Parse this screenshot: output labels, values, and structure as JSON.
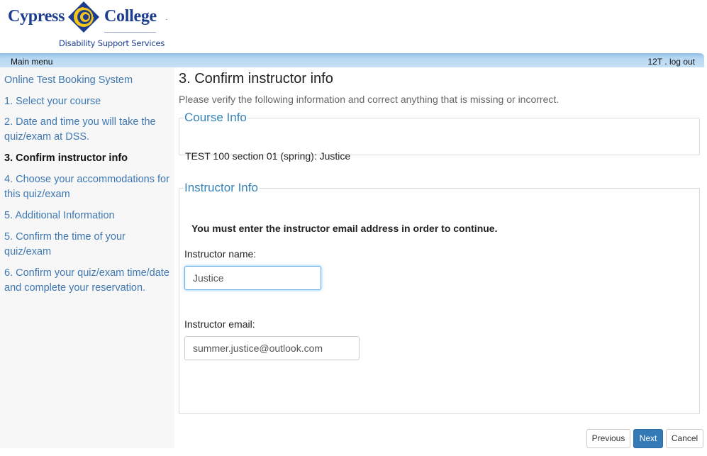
{
  "header": {
    "logo": {
      "word_left": "Cypress",
      "word_right": "College",
      "subtitle": "Disability Support Services",
      "colors": {
        "navy": "#1c3d8f",
        "gold": "#f5c518"
      }
    }
  },
  "menubar": {
    "main_menu_label": "Main menu",
    "user_label": "12T",
    "separator": " . ",
    "logout_label": "log out"
  },
  "sidebar": {
    "items": [
      {
        "label": "Online Test Booking System",
        "active": false
      },
      {
        "label": "1. Select your course",
        "active": false
      },
      {
        "label": "2. Date and time you will take the quiz/exam at DSS.",
        "active": false
      },
      {
        "label": "3. Confirm instructor info",
        "active": true
      },
      {
        "label": "4. Choose your accommodations for this quiz/exam",
        "active": false
      },
      {
        "label": "5. Additional Information",
        "active": false
      },
      {
        "label": "5. Confirm the time of your quiz/exam",
        "active": false
      },
      {
        "label": "6. Confirm your quiz/exam time/date and complete your reservation.",
        "active": false
      }
    ]
  },
  "main": {
    "title": "3. Confirm instructor info",
    "intro": "Please verify the following information and correct anything that is missing or incorrect.",
    "course_info": {
      "legend": "Course Info",
      "text": "TEST 100 section 01 (spring): Justice"
    },
    "instructor_info": {
      "legend": "Instructor Info",
      "warning": "You must enter the instructor email address in order to continue.",
      "name_label": "Instructor name:",
      "name_value": "Justice",
      "email_label": "Instructor email:",
      "email_value": "summer.justice@outlook.com"
    }
  },
  "buttons": {
    "previous": "Previous",
    "next": "Next",
    "cancel": "Cancel"
  },
  "colors": {
    "link": "#3e78b2",
    "legend": "#3483b8",
    "primary_button": "#337ab7",
    "menubar": "#b8d7f2",
    "sidebar_bg": "#f7f7f8"
  }
}
